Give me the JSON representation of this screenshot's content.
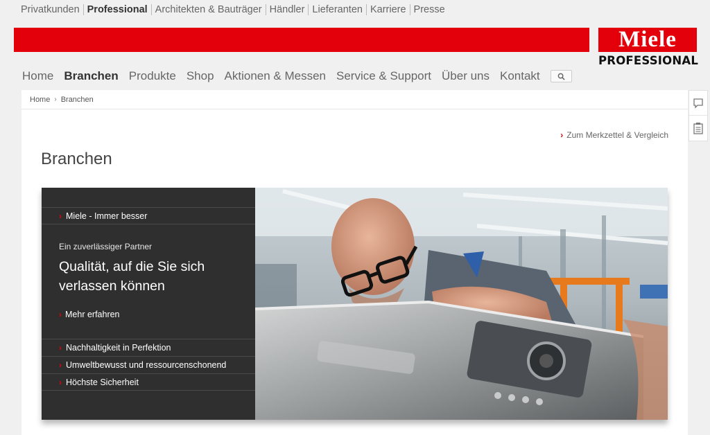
{
  "top_nav": {
    "items": [
      {
        "label": "Privatkunden",
        "active": false
      },
      {
        "label": "Professional",
        "active": true
      },
      {
        "label": "Architekten & Bauträger",
        "active": false
      },
      {
        "label": "Händler",
        "active": false
      },
      {
        "label": "Lieferanten",
        "active": false
      },
      {
        "label": "Karriere",
        "active": false
      },
      {
        "label": "Presse",
        "active": false
      }
    ]
  },
  "logo": {
    "brand": "Miele",
    "sub": "PROFESSIONAL"
  },
  "main_nav": {
    "items": [
      {
        "label": "Home",
        "active": false
      },
      {
        "label": "Branchen",
        "active": true
      },
      {
        "label": "Produkte",
        "active": false
      },
      {
        "label": "Shop",
        "active": false
      },
      {
        "label": "Aktionen & Messen",
        "active": false
      },
      {
        "label": "Service & Support",
        "active": false
      },
      {
        "label": "Über uns",
        "active": false
      },
      {
        "label": "Kontakt",
        "active": false
      }
    ],
    "search_icon": "search-icon"
  },
  "breadcrumb": {
    "items": [
      "Home",
      "Branchen"
    ]
  },
  "merkzettel_link": "Zum Merkzettel & Vergleich",
  "page_title": "Branchen",
  "hero": {
    "top_link": "Miele - Immer besser",
    "eyebrow": "Ein zuverlässiger Partner",
    "headline": "Qualität, auf die Sie sich verlassen können",
    "more_link": "Mehr erfahren",
    "bottom_links": [
      "Nachhaltigkeit in Perfektion",
      "Umweltbewusst und ressourcenschonend",
      "Höchste Sicherheit"
    ]
  },
  "colors": {
    "brand_red": "#e3000b",
    "dark_panel": "#2f2f2f"
  }
}
